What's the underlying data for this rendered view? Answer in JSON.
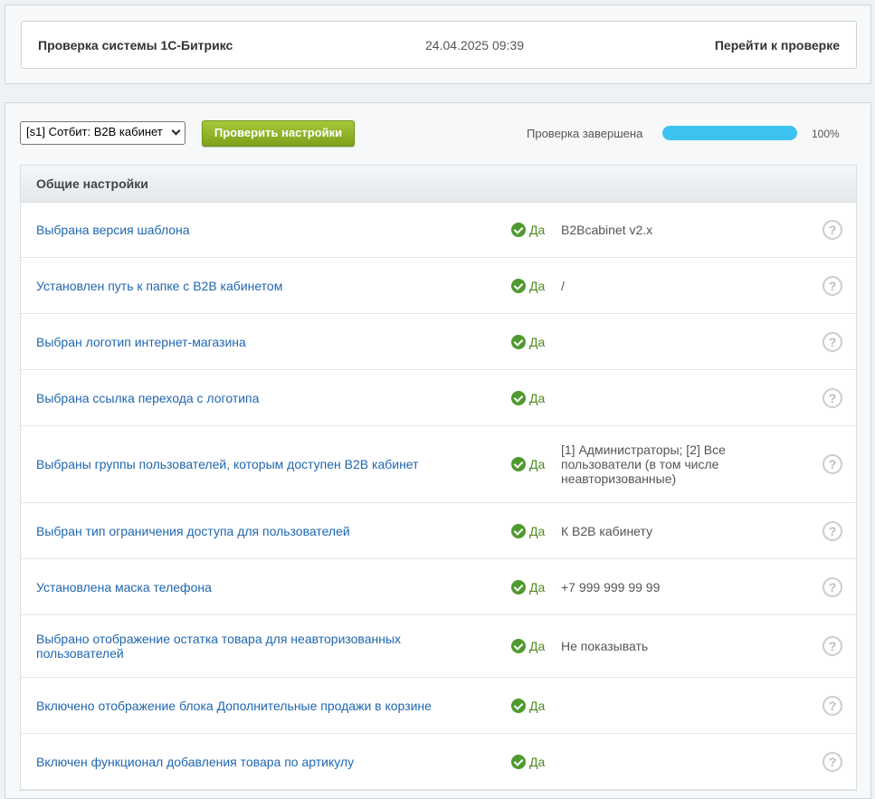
{
  "header": {
    "title": "Проверка системы 1С-Битрикс",
    "datetime": "24.04.2025 09:39",
    "goto_link": "Перейти к проверке"
  },
  "toolbar": {
    "site_select_value": "[s1] Сотбит: B2B кабинет",
    "check_button": "Проверить настройки",
    "status_text": "Проверка завершена",
    "progress_percent": 100,
    "progress_label": "100%",
    "progress_color": "#3bc2ef"
  },
  "section": {
    "title": "Общие настройки"
  },
  "rows": [
    {
      "name": "Выбрана версия шаблона",
      "status": "Да",
      "value": "B2Bcabinet v2.x"
    },
    {
      "name": "Установлен путь к папке с B2B кабинетом",
      "status": "Да",
      "value": "/"
    },
    {
      "name": "Выбран логотип интернет-магазина",
      "status": "Да",
      "value": ""
    },
    {
      "name": "Выбрана ссылка перехода с логотипа",
      "status": "Да",
      "value": ""
    },
    {
      "name": "Выбраны группы пользователей, которым доступен B2B кабинет",
      "status": "Да",
      "value": "[1] Администраторы; [2] Все пользователи (в том числе неавторизованные)"
    },
    {
      "name": "Выбран тип ограничения доступа для пользователей",
      "status": "Да",
      "value": "К B2B кабинету"
    },
    {
      "name": "Установлена маска телефона",
      "status": "Да",
      "value": "+7 999 999 99 99"
    },
    {
      "name": "Выбрано отображение остатка товара для неавторизованных пользователей",
      "status": "Да",
      "value": "Не показывать"
    },
    {
      "name": "Включено отображение блока Дополнительные продажи в корзине",
      "status": "Да",
      "value": ""
    },
    {
      "name": "Включен функционал добавления товара по артикулу",
      "status": "Да",
      "value": ""
    }
  ],
  "icons": {
    "status": "check-circle-icon",
    "help": "question-circle-icon",
    "help_glyph": "?"
  }
}
